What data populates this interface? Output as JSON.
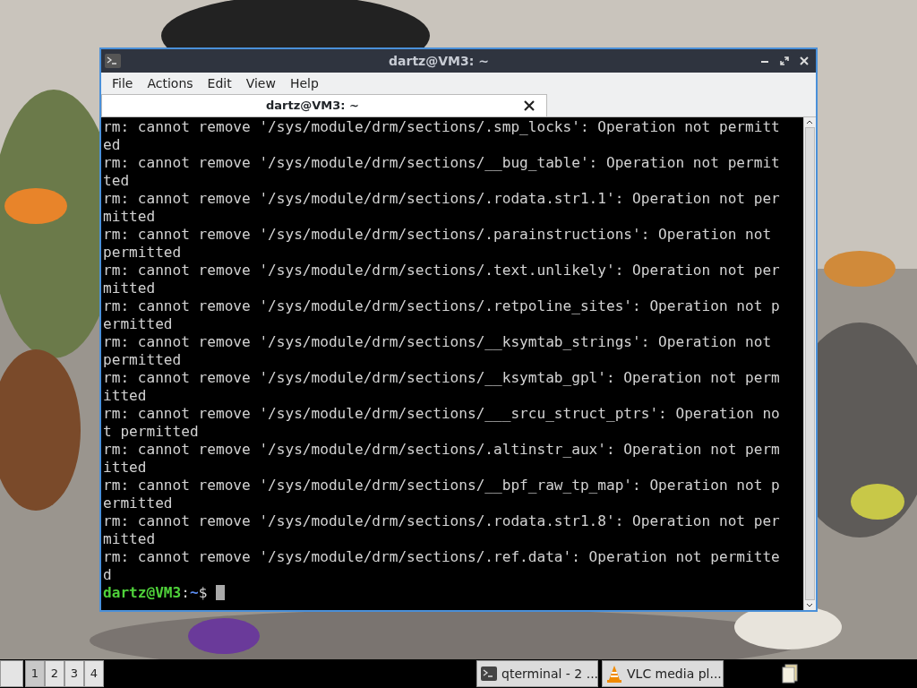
{
  "window": {
    "title": "dartz@VM3: ~"
  },
  "menu": [
    {
      "label": "File"
    },
    {
      "label": "Actions"
    },
    {
      "label": "Edit"
    },
    {
      "label": "View"
    },
    {
      "label": "Help"
    }
  ],
  "tabs": [
    {
      "label": "dartz@VM3: ~",
      "selected": true
    }
  ],
  "terminal": {
    "lines": [
      "rm: cannot remove '/sys/module/drm/sections/.smp_locks': Operation not permitt",
      "ed",
      "rm: cannot remove '/sys/module/drm/sections/__bug_table': Operation not permit",
      "ted",
      "rm: cannot remove '/sys/module/drm/sections/.rodata.str1.1': Operation not per",
      "mitted",
      "rm: cannot remove '/sys/module/drm/sections/.parainstructions': Operation not",
      "permitted",
      "rm: cannot remove '/sys/module/drm/sections/.text.unlikely': Operation not per",
      "mitted",
      "rm: cannot remove '/sys/module/drm/sections/.retpoline_sites': Operation not p",
      "ermitted",
      "rm: cannot remove '/sys/module/drm/sections/__ksymtab_strings': Operation not",
      "permitted",
      "rm: cannot remove '/sys/module/drm/sections/__ksymtab_gpl': Operation not perm",
      "itted",
      "rm: cannot remove '/sys/module/drm/sections/___srcu_struct_ptrs': Operation no",
      "t permitted",
      "rm: cannot remove '/sys/module/drm/sections/.altinstr_aux': Operation not perm",
      "itted",
      "rm: cannot remove '/sys/module/drm/sections/__bpf_raw_tp_map': Operation not p",
      "ermitted",
      "rm: cannot remove '/sys/module/drm/sections/.rodata.str1.8': Operation not per",
      "mitted",
      "rm: cannot remove '/sys/module/drm/sections/.ref.data': Operation not permitte",
      "d"
    ],
    "prompt": {
      "user_host": "dartz@VM3",
      "separator": ":",
      "path": "~",
      "symbol": "$"
    }
  },
  "taskbar": {
    "workspaces": [
      {
        "label": "1",
        "selected": true
      },
      {
        "label": "2",
        "selected": false
      },
      {
        "label": "3",
        "selected": false
      },
      {
        "label": "4",
        "selected": false
      }
    ],
    "tasks": [
      {
        "label": "qterminal - 2 ...",
        "kind": "terminal",
        "selected": false
      },
      {
        "label": "VLC media pl...",
        "kind": "vlc",
        "selected": false
      }
    ]
  }
}
